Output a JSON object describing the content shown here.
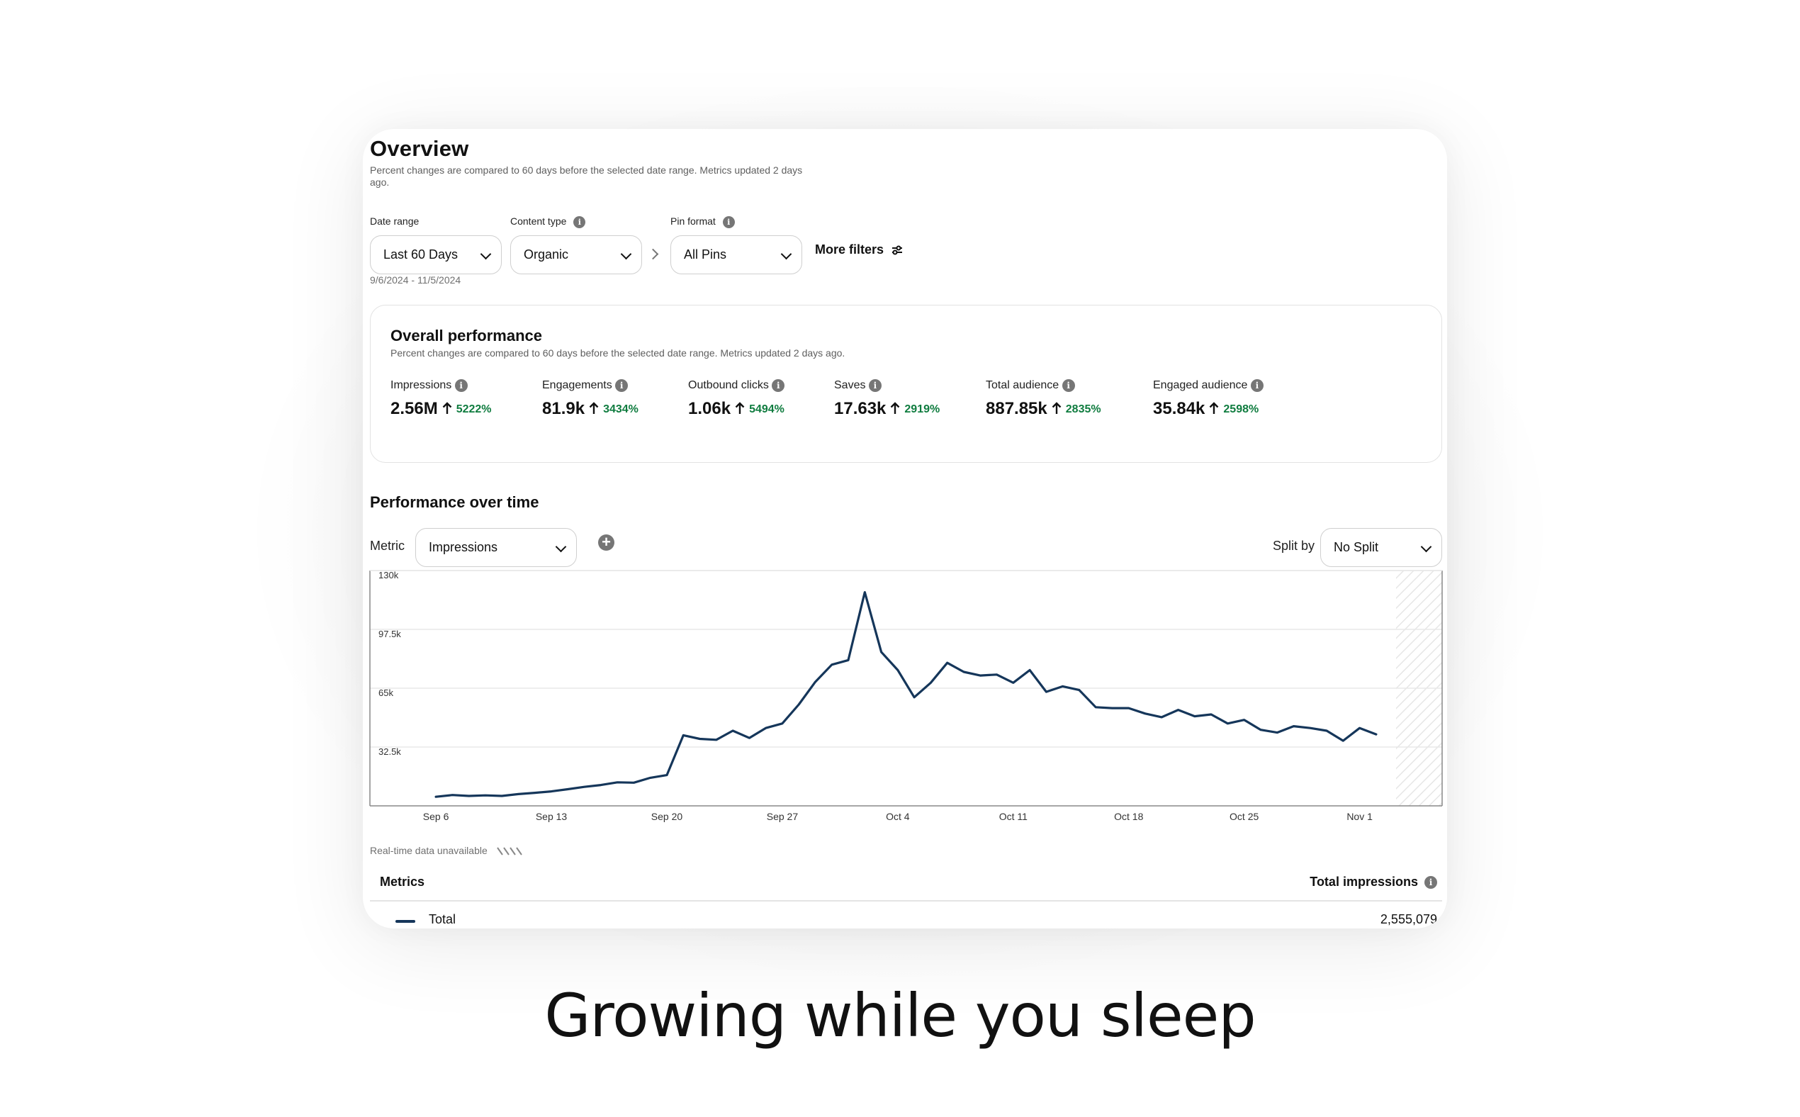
{
  "overview": {
    "title": "Overview",
    "subtitle": "Percent changes are compared to 60 days before the selected date range. Metrics updated 2 days ago."
  },
  "filters": {
    "date_range_label": "Date range",
    "date_range_value": "Last 60 Days",
    "date_range_text": "9/6/2024 - 11/5/2024",
    "content_type_label": "Content type",
    "content_type_value": "Organic",
    "pin_format_label": "Pin format",
    "pin_format_value": "All Pins",
    "more_filters": "More filters"
  },
  "overall": {
    "title": "Overall performance",
    "subtitle": "Percent changes are compared to 60 days before the selected date range. Metrics updated 2 days ago.",
    "metrics": [
      {
        "name": "Impressions",
        "value": "2.56M",
        "change": "5222%"
      },
      {
        "name": "Engagements",
        "value": "81.9k",
        "change": "3434%"
      },
      {
        "name": "Outbound clicks",
        "value": "1.06k",
        "change": "5494%"
      },
      {
        "name": "Saves",
        "value": "17.63k",
        "change": "2919%"
      },
      {
        "name": "Total audience",
        "value": "887.85k",
        "change": "2835%"
      },
      {
        "name": "Engaged audience",
        "value": "35.84k",
        "change": "2598%"
      }
    ]
  },
  "performance": {
    "title": "Performance over time",
    "metric_label": "Metric",
    "metric_value": "Impressions",
    "split_label": "Split by",
    "split_value": "No Split",
    "realtime_text": "Real-time data unavailable"
  },
  "chart_data": {
    "type": "line",
    "y_tick_labels": [
      "130k",
      "97.5k",
      "65k",
      "32.5k"
    ],
    "y_ticks": [
      130000,
      97500,
      65000,
      32500
    ],
    "ylim": [
      0,
      130000
    ],
    "x_tick_labels": [
      "Sep 6",
      "Sep 13",
      "Sep 20",
      "Sep 27",
      "Oct 4",
      "Oct 11",
      "Oct 18",
      "Oct 25",
      "Nov 1"
    ],
    "x_tick_days": [
      0,
      7,
      14,
      21,
      28,
      35,
      42,
      49,
      56
    ],
    "xlim": [
      -4,
      61
    ],
    "grid": true,
    "line_color": "#15365a",
    "series": [
      {
        "values": [
          5000,
          6000,
          5500,
          5800,
          5500,
          6500,
          7200,
          8000,
          9200,
          10500,
          11500,
          13000,
          12800,
          15500,
          17000,
          39000,
          37000,
          36500,
          41500,
          37500,
          43000,
          45500,
          56000,
          68500,
          78000,
          80500,
          118000,
          85000,
          75000,
          60000,
          68000,
          79000,
          74000,
          72000,
          72500,
          68000,
          75000,
          63000,
          66000,
          64000,
          54500,
          54000,
          54000,
          51000,
          49000,
          53000,
          49500,
          50500,
          45500,
          47500,
          42000,
          40500,
          44000,
          43000,
          41500,
          36000,
          43000,
          39500
        ]
      }
    ]
  },
  "table": {
    "metrics_header": "Metrics",
    "total_header": "Total impressions",
    "row_label": "Total",
    "row_value": "2,555,079"
  },
  "tagline": "Growing while you sleep"
}
